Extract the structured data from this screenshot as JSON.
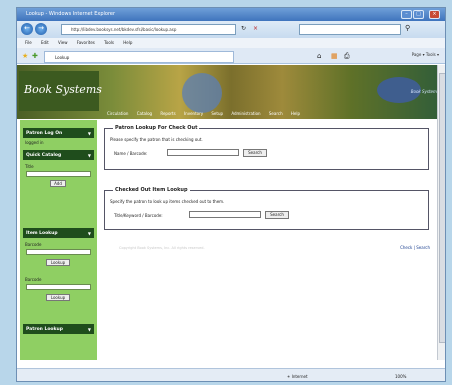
{
  "browser": {
    "title": "Lookup - Windows Internet Explorer",
    "url": "http://libdev.booksys.net/bkdev.sfsi/basic/lookup.asp",
    "menu": [
      "File",
      "Edit",
      "View",
      "Favorites",
      "Tools",
      "Help"
    ],
    "tab_label": "Lookup",
    "toolbar_right": "Page ▾  Tools ▾",
    "status_zone": "Internet",
    "zoom": "100%"
  },
  "site": {
    "logo": "Book Systems",
    "brand": "Book Systems",
    "nav": [
      "Circulation",
      "Catalog",
      "Reports",
      "Inventory",
      "Setup",
      "Administration",
      "Search",
      "Help"
    ]
  },
  "sidebar": {
    "patron_logon": {
      "title": "Patron Log On",
      "value": "logged in"
    },
    "quick_catalog": {
      "title": "Quick Catalog",
      "label": "Title",
      "button": "Add"
    },
    "item_lookup": {
      "title": "Item Lookup",
      "label1": "Barcode",
      "button1": "Lookup",
      "label2": "Barcode",
      "button2": "Lookup"
    },
    "patron_lookup": {
      "title": "Patron Lookup"
    }
  },
  "main": {
    "patron_box": {
      "legend": "Patron Lookup For Check Out",
      "desc": "Please specify the patron that is checking out.",
      "label": "Name / Barcode:",
      "button": "Search"
    },
    "item_box": {
      "legend": "Checked Out Item Lookup",
      "desc": "Specify the patron to look up items checked out to them.",
      "label": "Title/Keyword / Barcode:",
      "button": "Search"
    },
    "footer_text": "Copyright Book Systems, Inc. All rights reserved.",
    "footer_links": "Check  |  Search"
  }
}
